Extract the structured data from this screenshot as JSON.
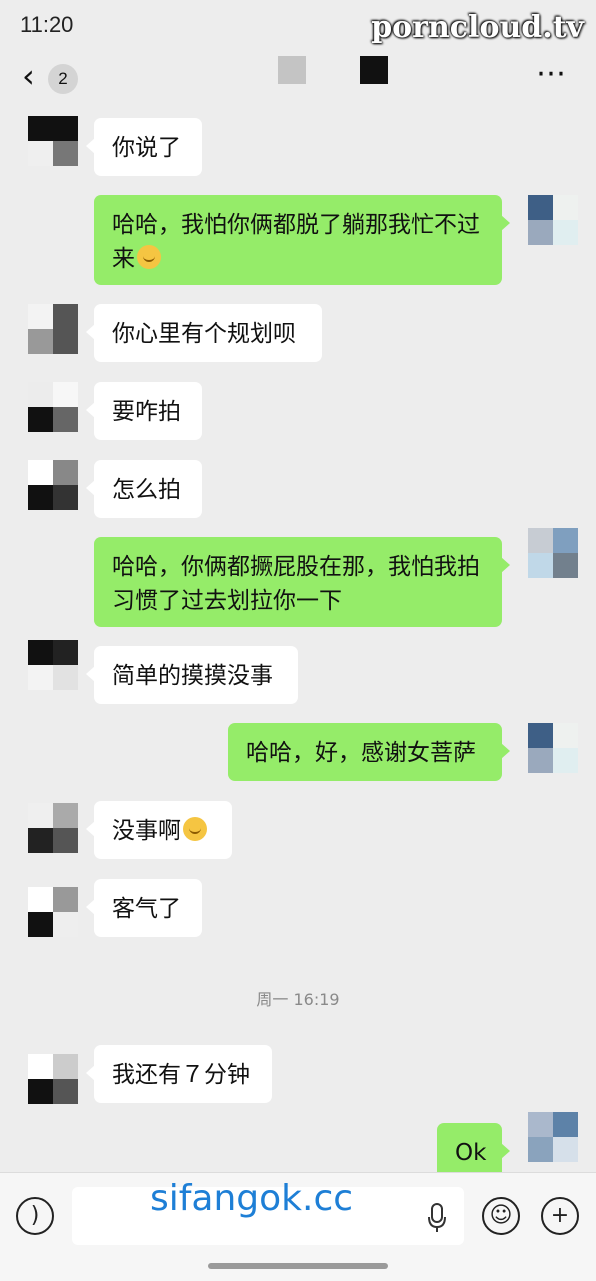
{
  "status": {
    "time": "11:20",
    "watermark": "porncloud.tv"
  },
  "nav": {
    "back_icon": "chevron-left-icon",
    "unread_count": "2",
    "more_icon": "more-dots-icon"
  },
  "messages": [
    {
      "dir": "in",
      "text": "你说了"
    },
    {
      "dir": "out",
      "text": "哈哈，我怕你俩都脱了躺那我忙不过来",
      "emoji": "sneeze-face-emoji"
    },
    {
      "dir": "in",
      "text": "你心里有个规划呗"
    },
    {
      "dir": "in",
      "text": "要咋拍"
    },
    {
      "dir": "in",
      "text": "怎么拍"
    },
    {
      "dir": "out",
      "text": "哈哈，你俩都撅屁股在那，我怕我拍习惯了过去划拉你一下"
    },
    {
      "dir": "in",
      "text": "简单的摸摸没事"
    },
    {
      "dir": "out",
      "text": "哈哈，好，感谢女菩萨"
    },
    {
      "dir": "in",
      "text": "没事啊",
      "emoji": "laugh-tears-emoji"
    },
    {
      "dir": "in",
      "text": "客气了"
    },
    {
      "dir": "in",
      "text": "我还有７分钟"
    },
    {
      "dir": "out",
      "text": "Ok"
    }
  ],
  "timestamp": "周一 16:19",
  "input_bar": {
    "voice_icon": "voice-icon",
    "mic_icon": "mic-icon",
    "emoji_icon": "smiley-icon",
    "plus_icon": "plus-icon",
    "watermark": "sifangok.cc"
  }
}
